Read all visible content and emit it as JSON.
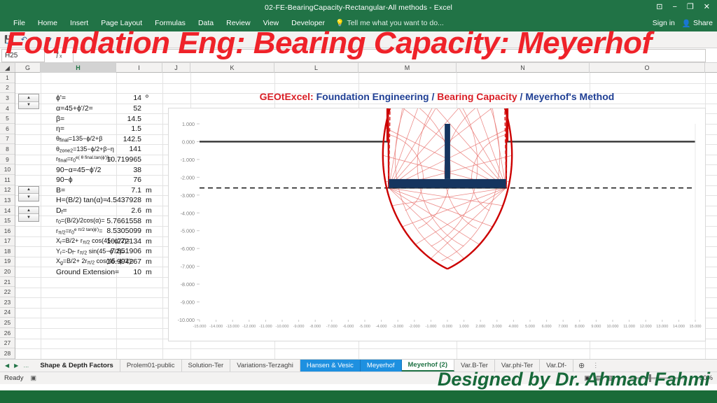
{
  "window": {
    "doc_title": "02-FE-BearingCapacity-Rectangular-All methods - Excel",
    "restore_icon": "⊡",
    "minimize_icon": "−",
    "maximize_icon": "❐",
    "close_icon": "✕"
  },
  "ribbon": {
    "tabs": [
      "File",
      "Home",
      "Insert",
      "Page Layout",
      "Formulas",
      "Data",
      "Review",
      "View",
      "Developer"
    ],
    "tellme_icon": "lightbulb-icon",
    "tellme_text": "Tell me what you want to do...",
    "sign_in": "Sign in",
    "share_icon": "person-share-icon",
    "share_label": "Share"
  },
  "qat": {
    "save_icon": "save-icon",
    "undo_icon": "undo-arrow-icon",
    "redo_icon": "redo-arrow-icon",
    "customize_icon": "chevron-down-icon"
  },
  "formula_bar": {
    "name_box_value": "H25",
    "fx_label": "fx",
    "formula_value": ""
  },
  "grid": {
    "columns": [
      "G",
      "H",
      "I",
      "J",
      "K",
      "L",
      "M",
      "N",
      "O"
    ],
    "selected_column": "H",
    "rows": [
      1,
      2,
      3,
      4,
      5,
      6,
      7,
      8,
      9,
      10,
      11,
      12,
      13,
      14,
      15,
      16,
      17,
      18,
      19,
      20,
      21,
      22,
      23,
      24,
      25,
      26,
      27,
      28
    ],
    "spinner_rows": [
      3,
      12,
      14
    ],
    "spinner_up_icon": "spinner-up-arrow",
    "spinner_down_icon": "spinner-down-arrow",
    "cells": [
      {
        "row": 3,
        "label_html": "ϕ'=",
        "value": "14",
        "unit": "º"
      },
      {
        "row": 4,
        "label_html": "α=45+ϕ'/2=",
        "value": "52",
        "unit": ""
      },
      {
        "row": 5,
        "label_html": "β=",
        "value": "14.5",
        "unit": ""
      },
      {
        "row": 6,
        "label_html": "η=",
        "value": "1.5",
        "unit": ""
      },
      {
        "row": 7,
        "label_html": "θ<sub>final</sub>=135−ϕ/2+β",
        "value": "142.5",
        "unit": ""
      },
      {
        "row": 8,
        "label_html": "θ<sub>zone2</sub>=135−ϕ/2+β−η",
        "value": "141",
        "unit": ""
      },
      {
        "row": 9,
        "label_html": "r<sub>final</sub>=r<sub>0</sub><sup>e( θ final.tan(ϕ')]</sup>=",
        "value": "10.719965",
        "unit": ""
      },
      {
        "row": 10,
        "label_html": "90−α=45−ϕ'/2",
        "value": "38",
        "unit": ""
      },
      {
        "row": 11,
        "label_html": "90−ϕ",
        "value": "76",
        "unit": ""
      },
      {
        "row": 12,
        "label_html": "B=",
        "value": "7.1",
        "unit": "m"
      },
      {
        "row": 13,
        "label_html": "H=(B/2) tan(α)=",
        "value": "4.5437928",
        "unit": "m"
      },
      {
        "row": 14,
        "label_html": "D<sub>f</sub>=",
        "value": "2.6",
        "unit": "m"
      },
      {
        "row": 15,
        "label_html": "r<sub>0</sub>=(B/2)/2cos(α)=",
        "value": "5.7661558",
        "unit": "m"
      },
      {
        "row": 16,
        "label_html": "r<sub>π/2</sub>=r<sub>0</sub><sup>e π/2 tan(ϕ')</sup>=",
        "value": "8.5305099",
        "unit": "m"
      },
      {
        "row": 17,
        "label_html": "X<sub>r</sub>=B/2+ r<sub>π/2</sub> cos(45−ϕ'/2)=",
        "value": "10.272134",
        "unit": "m"
      },
      {
        "row": 18,
        "label_html": "Y<sub>r</sub>=-D<sub>f</sub>- r<sub>π/2</sub> sin(45−ϕ'/2)=",
        "value": "-7.851906",
        "unit": "m"
      },
      {
        "row": 19,
        "label_html": "X<sub>g</sub>=B/2+ 2r<sub>π/2</sub> cos(45−ϕ'/2)=",
        "value": "16.994267",
        "unit": "m"
      },
      {
        "row": 20,
        "label_html": "Ground Extension=",
        "value": "10",
        "unit": "m"
      }
    ]
  },
  "chart_data": {
    "type": "line",
    "title_parts": [
      {
        "text": "GEOtExcel:",
        "color": "#d91f26"
      },
      {
        "text": "Foundation Engineering",
        "color": "#1f3f94"
      },
      {
        "text": "/",
        "color": "#1f3f94"
      },
      {
        "text": "Bearing Capacity",
        "color": "#d91f26"
      },
      {
        "text": "/",
        "color": "#1f3f94"
      },
      {
        "text": "Meyerhof's Method",
        "color": "#1f3f94"
      }
    ],
    "title": "GEOtExcel: Foundation Engineering / Bearing Capacity / Meyerhof's Method",
    "xlabel": "",
    "ylabel": "",
    "xlim": [
      -15,
      15
    ],
    "ylim": [
      -10,
      1
    ],
    "xticks": [
      "-15.000",
      "-14.000",
      "-13.000",
      "-12.000",
      "-11.000",
      "-10.000",
      "-9.000",
      "-8.000",
      "-7.000",
      "-6.000",
      "-5.000",
      "-4.000",
      "-3.000",
      "-2.000",
      "-1.000",
      "0.000",
      "1.000",
      "2.000",
      "3.000",
      "4.000",
      "5.000",
      "6.000",
      "7.000",
      "8.000",
      "9.000",
      "10.000",
      "11.000",
      "12.000",
      "13.000",
      "14.000",
      "15.000"
    ],
    "yticks": [
      "1.000",
      "0.000",
      "-1.000",
      "-2.000",
      "-3.000",
      "-4.000",
      "-5.000",
      "-6.000",
      "-7.000",
      "-8.000",
      "-9.000",
      "-10.000"
    ],
    "grid": false,
    "legend": "none",
    "series": [
      {
        "name": "ground-surface",
        "color": "#333333",
        "style": "solid",
        "width": 2.2,
        "comment": "ground line y=0 from x=-15 to -3.55 and +3.55 to +15"
      },
      {
        "name": "excavation-walls",
        "color": "#333333",
        "style": "solid",
        "width": 1.6,
        "comment": "vertical walls at x=-3.55 and x=+3.55 from y=0 down to y=-2.6"
      },
      {
        "name": "footing-base",
        "color": "#16355f",
        "style": "solid",
        "width": 7,
        "comment": "horizontal footing slab at y=-2.6 from x=-3.55 to x=3.55, width B=7.1 m"
      },
      {
        "name": "footing-column",
        "color": "#16355f",
        "style": "solid",
        "width": 6,
        "comment": "vertical stem at x=0 from y=-2.6 up to y=+1.0"
      },
      {
        "name": "foundation-level-datum",
        "color": "#000000",
        "style": "dashed",
        "width": 1.4,
        "comment": "dashed datum line at y = -2.6 across full width"
      },
      {
        "name": "log-spiral-left",
        "color": "#cc0000",
        "style": "solid",
        "width": 2.4,
        "comment": "log spiral from left footing edge sweeping down/left, r0=5.766, rfinal=10.72"
      },
      {
        "name": "log-spiral-right",
        "color": "#cc0000",
        "style": "solid",
        "width": 2.4,
        "comment": "mirror of left spiral"
      },
      {
        "name": "failure-surface-left",
        "color": "#cc0000",
        "style": "solid",
        "width": 2.2,
        "comment": "straight rupture line from left footing edge up-left to ground at x=-14.0"
      },
      {
        "name": "failure-surface-right",
        "color": "#cc0000",
        "style": "solid",
        "width": 2.2,
        "comment": "mirror rupture line to ground at x=+14.0"
      },
      {
        "name": "zone2-dashed-left",
        "color": "#e03030",
        "style": "dashed",
        "width": 1.6,
        "comment": "zone-2 alternative line, theta_zone2 = 141 deg"
      },
      {
        "name": "zone2-dashed-right",
        "color": "#e03030",
        "style": "dashed",
        "width": 1.6
      },
      {
        "name": "radial-rays",
        "color": "#e8736f",
        "style": "solid",
        "width": 0.8,
        "comment": "12 radial rays per side fanning from each footing edge"
      },
      {
        "name": "spiral-arcs",
        "color": "#e8736f",
        "style": "solid",
        "width": 0.8,
        "comment": "4 intermediate log-spiral arcs per side"
      }
    ],
    "geometry": {
      "B": 7.1,
      "Df": 2.6,
      "phi": 14,
      "alpha": 52,
      "beta": 14.5,
      "eta": 1.5,
      "theta_final": 142.5,
      "theta_zone2": 141,
      "r0": 5.7661558,
      "r_final": 10.719965,
      "r_pi2": 8.5305099,
      "ground_extension": 10,
      "Xr": 10.272134,
      "Yr": -7.851906,
      "Xg": 16.994267
    }
  },
  "sheet_tabs": {
    "nav_first_icon": "◀",
    "nav_last_icon": "▶",
    "nav_more_icon": "…",
    "tabs": [
      {
        "label": "Shape & Depth Factors",
        "state": "bold"
      },
      {
        "label": "Prolem01-public",
        "state": "normal"
      },
      {
        "label": "Solution-Ter",
        "state": "normal"
      },
      {
        "label": "Variations-Terzaghi",
        "state": "normal"
      },
      {
        "label": "Hansen &  Vesic",
        "state": "selected"
      },
      {
        "label": "Meyerhof",
        "state": "selected"
      },
      {
        "label": "Meyerhof (2)",
        "state": "active"
      },
      {
        "label": "Var.B-Ter",
        "state": "normal"
      },
      {
        "label": "Var.phi-Ter",
        "state": "normal"
      },
      {
        "label": "Var.Df-",
        "state": "normal"
      }
    ],
    "add_sheet_icon": "⊕",
    "overflow_icon": "⋮"
  },
  "status_bar": {
    "ready_text": "Ready",
    "macro_icon": "record-macro-icon",
    "view_normal_icon": "normal-view-icon",
    "view_layout_icon": "page-layout-icon",
    "view_break_icon": "page-break-icon",
    "zoom_out_icon": "−",
    "zoom_in_icon": "+",
    "zoom_level": "80%"
  },
  "overlays": {
    "banner_title": "Foundation Eng: Bearing Capacity: Meyerhof",
    "author_credit": "Designed by Dr. Ahmad Fahmi"
  },
  "colors": {
    "excel_green": "#217346",
    "accent_red": "#d91f26",
    "accent_blue": "#1f3f94",
    "footing_navy": "#16355f",
    "spiral_red": "#cc0000",
    "banner_red": "#ef2229",
    "author_green": "#17693a"
  }
}
